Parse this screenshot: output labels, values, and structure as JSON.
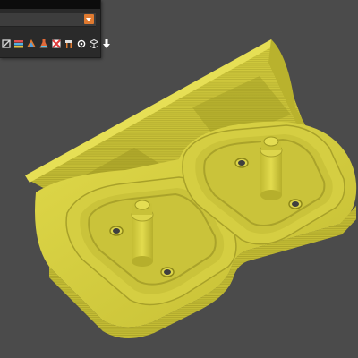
{
  "app": {
    "view_mode_value": "",
    "accent_color": "#e07a30",
    "model_color": "#c9c23a",
    "viewport_background": "#4b4b4b"
  },
  "toolbar": {
    "tools": [
      {
        "icon": "cut-view-icon"
      },
      {
        "icon": "layer-color-icon"
      },
      {
        "icon": "object-color-icon"
      },
      {
        "icon": "flask-icon"
      },
      {
        "icon": "error-marker-icon"
      },
      {
        "icon": "support-icon"
      },
      {
        "icon": "orbit-icon"
      },
      {
        "icon": "cube-icon"
      },
      {
        "icon": "download-arrow-icon"
      }
    ]
  }
}
